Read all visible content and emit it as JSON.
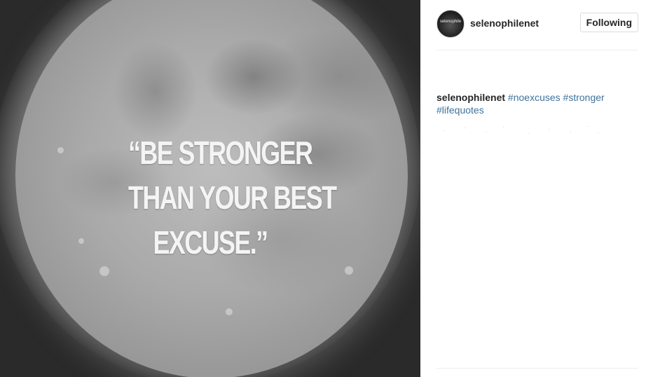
{
  "post": {
    "image_quote_lines": [
      "“BE STRONGER",
      "THAN YOUR BEST",
      "EXCUSE.”"
    ]
  },
  "header": {
    "avatar_label": "selenophile",
    "username": "selenophilenet",
    "follow_button_label": "Following"
  },
  "caption": {
    "username": "selenophilenet",
    "hashtags": [
      "#noexcuses",
      "#stronger",
      "#lifequotes"
    ]
  },
  "colors": {
    "hashtag": "#3f729b",
    "text": "#262626",
    "border": "#dbdbdb"
  }
}
